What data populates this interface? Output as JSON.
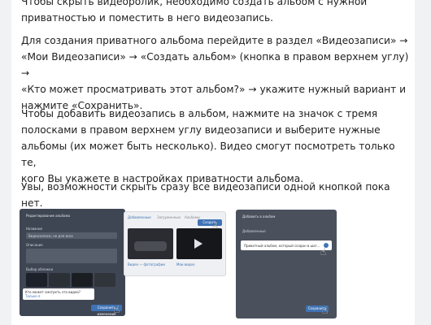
{
  "paragraphs": {
    "p1_l1": "Чтобы скрыть видеоролик, необходимо создать альбом с нужной",
    "p1_l2": "приватностью и поместить в него видеозапись.",
    "p2_l1": "Для создания приватного альбома перейдите в раздел «Видеозаписи» →",
    "p2_l2": "«Мои Видеозаписи» → «Создать альбом» (кнопка в правом верхнем углу) →",
    "p2_l3": "«Кто может просматривать этот альбом?» → укажите нужный вариант и",
    "p2_l4": "нажмите «Сохранить».",
    "p3_l1": "Чтобы добавить видеозапись в альбом, нажмите на значок с тремя",
    "p3_l2": "полосками в правом верхнем углу видеозаписи и выберите нужные",
    "p3_l3": "альбомы (их может быть несколько). Видео смогут посмотреть только те,",
    "p3_l4": "кого Вы укажете в настройках приватности альбома.",
    "p4_l1": "Увы, возможности скрыть сразу все видеозаписи одной кнопкой пока нет."
  },
  "screenshot1": {
    "title": "Редактирование альбома",
    "field1": "Название",
    "value1": "Видеозаписи, не для всех",
    "field2": "Описание",
    "section": "Выбор обложки",
    "question": "Кто может смотреть это видео?",
    "answer": "Только я",
    "save": "Сохранить изменения"
  },
  "screenshot2": {
    "tab1": "Добавленные",
    "tab2": "Загруженные",
    "tab3": "Альбомы",
    "create": "Создать альбом",
    "caption1": "Видео — фотографии",
    "caption2": "Мои видео"
  },
  "screenshot3": {
    "title": "Добавить в альбом",
    "subtitle": "Добавленные",
    "item": "Приватный альбом, который создан в шаг...",
    "save": "Сохранить"
  }
}
